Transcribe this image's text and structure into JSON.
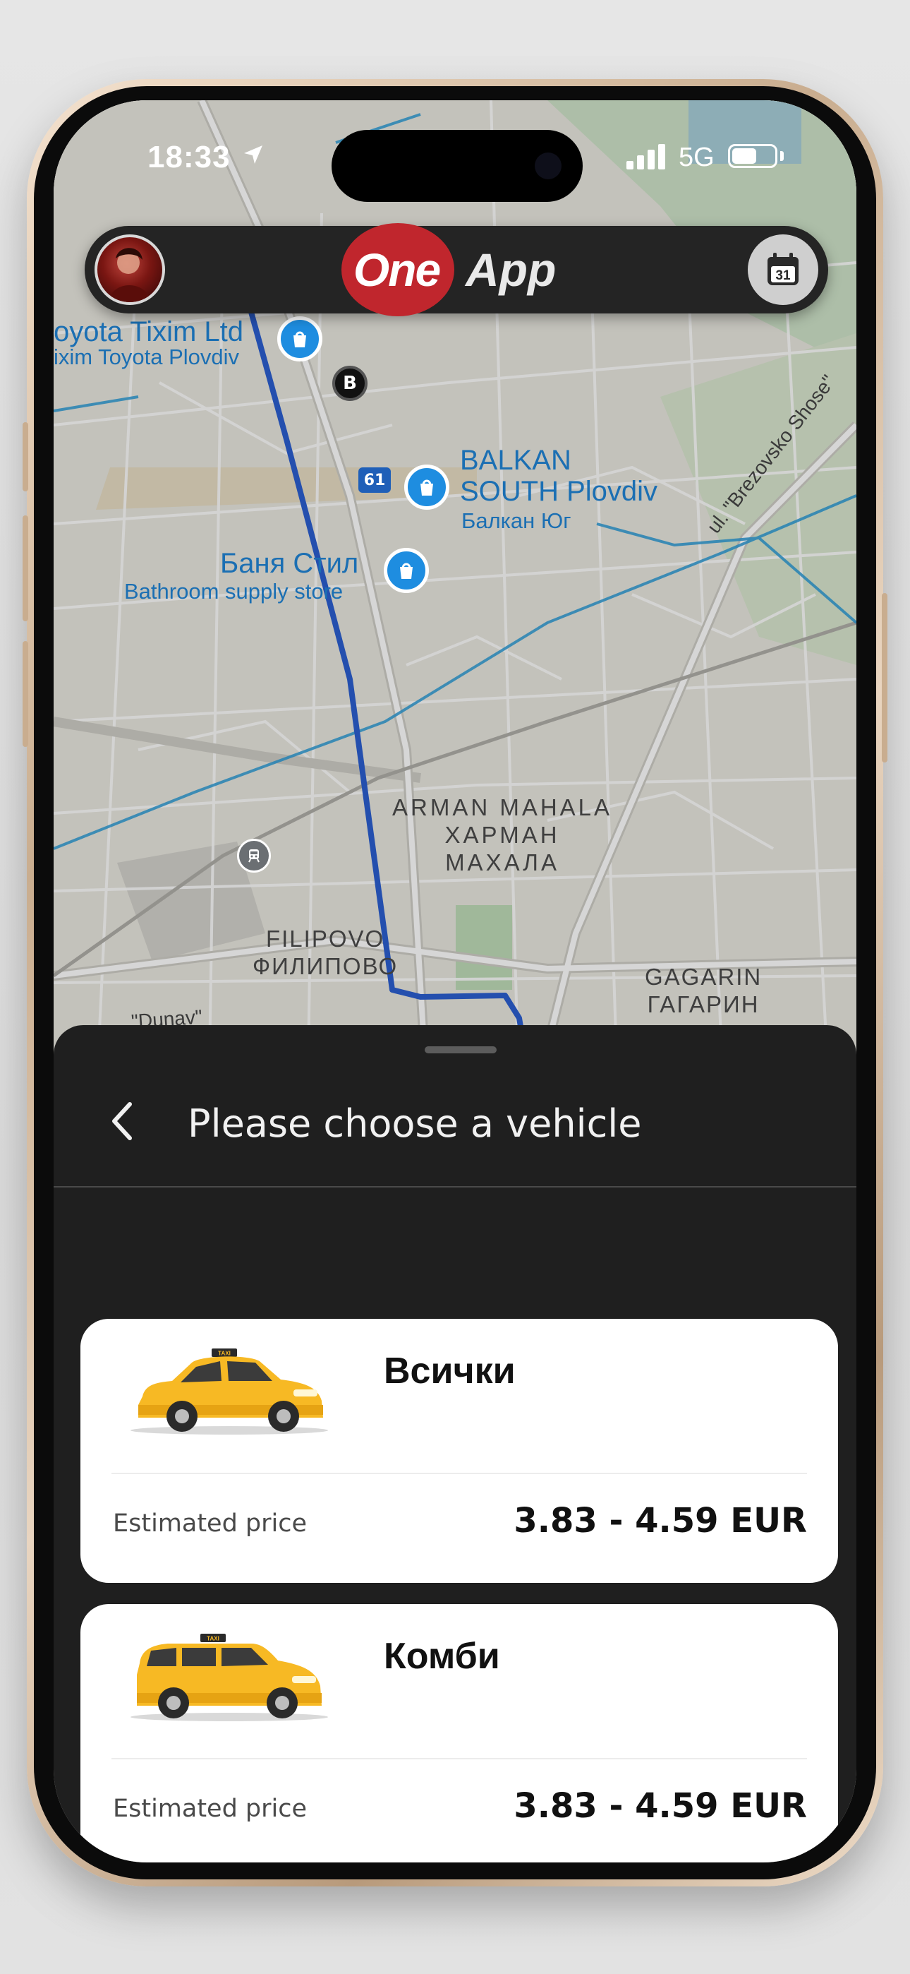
{
  "status_bar": {
    "time": "18:33",
    "network": "5G"
  },
  "header": {
    "logo_part1": "One",
    "logo_part2": "App",
    "calendar_day": "31"
  },
  "map": {
    "poi": [
      {
        "name": "oyota Tixim Ltd",
        "sub": "ixim Toyota Plovdiv"
      },
      {
        "name": "BALKAN",
        "name2": "SOUTH Plovdiv",
        "sub": "Балкан Юг"
      },
      {
        "name": "Баня Стил",
        "sub": "Bathroom supply store"
      }
    ],
    "districts": [
      {
        "line1": "ARMAN MAHALA",
        "line2": "ХАРМАН",
        "line3": "МАХАЛА"
      },
      {
        "line1": "FILIPOVO",
        "line2": "ФИЛИПОВО"
      },
      {
        "line1": "GAGARIN",
        "line2": "ГАГАРИН"
      }
    ],
    "street_label": "ul. \"Brezovsko Shose\"",
    "street_label_2": "\"Dunav\"",
    "route_marker": "B",
    "road_number": "61"
  },
  "sheet": {
    "title": "Please choose a vehicle",
    "vehicles": [
      {
        "name": "Всички",
        "price_label": "Estimated price",
        "price": "3.83 - 4.59 EUR",
        "taxi_sign": "TAXI"
      },
      {
        "name": "Комби",
        "price_label": "Estimated price",
        "price": "3.83 - 4.59 EUR",
        "taxi_sign": "TAXI"
      }
    ]
  },
  "colors": {
    "taxi_yellow": "#f7b924",
    "sheet_bg": "#1f1f1f",
    "route_blue": "#2b5fd0",
    "brand_red": "#c0262d"
  }
}
